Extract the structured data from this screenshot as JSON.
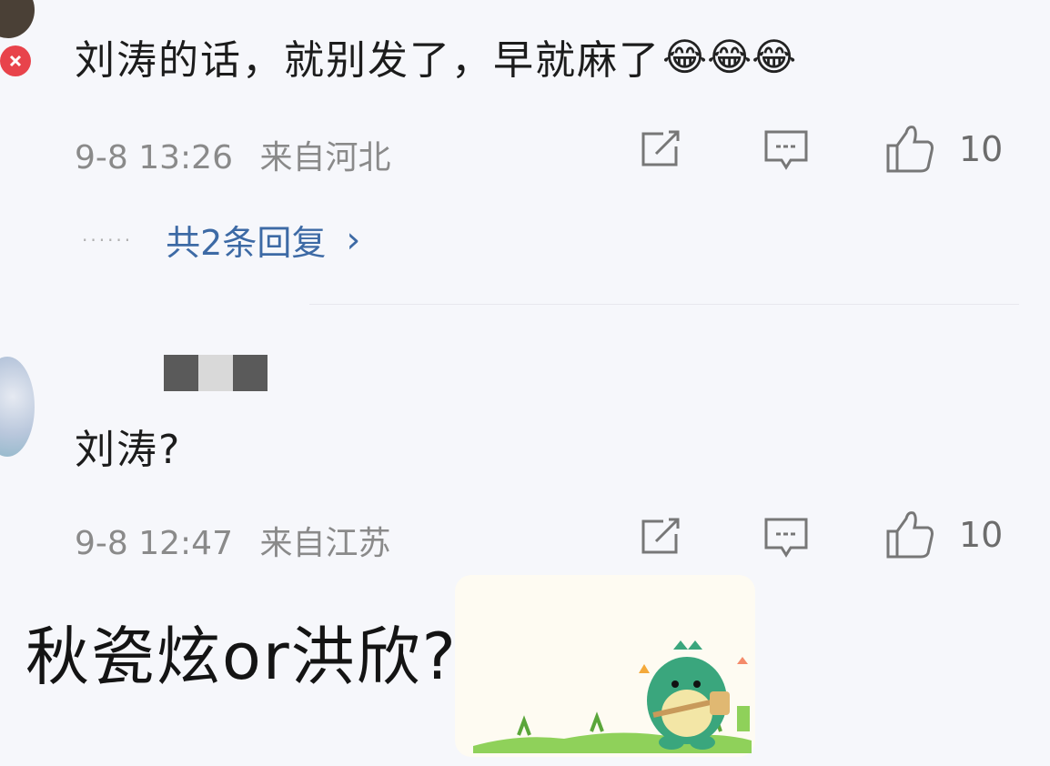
{
  "comments": [
    {
      "text": "刘涛的话，就别发了，早就麻了",
      "emoji": [
        "😂",
        "😂",
        "😂"
      ],
      "timestamp": "9-8 13:26",
      "location": "来自河北",
      "likes": "10",
      "replies_link": "共2条回复",
      "replies_chevron": "›",
      "replies_dots": "······"
    },
    {
      "text": "刘涛?",
      "timestamp": "9-8 12:47",
      "location": "来自江苏",
      "likes": "10"
    }
  ],
  "caption": "秋瓷炫or洪欣?",
  "colors": {
    "background": "#f6f7fb",
    "link": "#3d6aa5",
    "meta": "#8a8a8a",
    "mascot": "#3aa67d",
    "grass": "#7cc24a"
  },
  "icons": [
    "repost-icon",
    "comment-icon",
    "thumbs-up-icon",
    "chevron-right-icon",
    "mascot-dinosaur-sticker"
  ]
}
